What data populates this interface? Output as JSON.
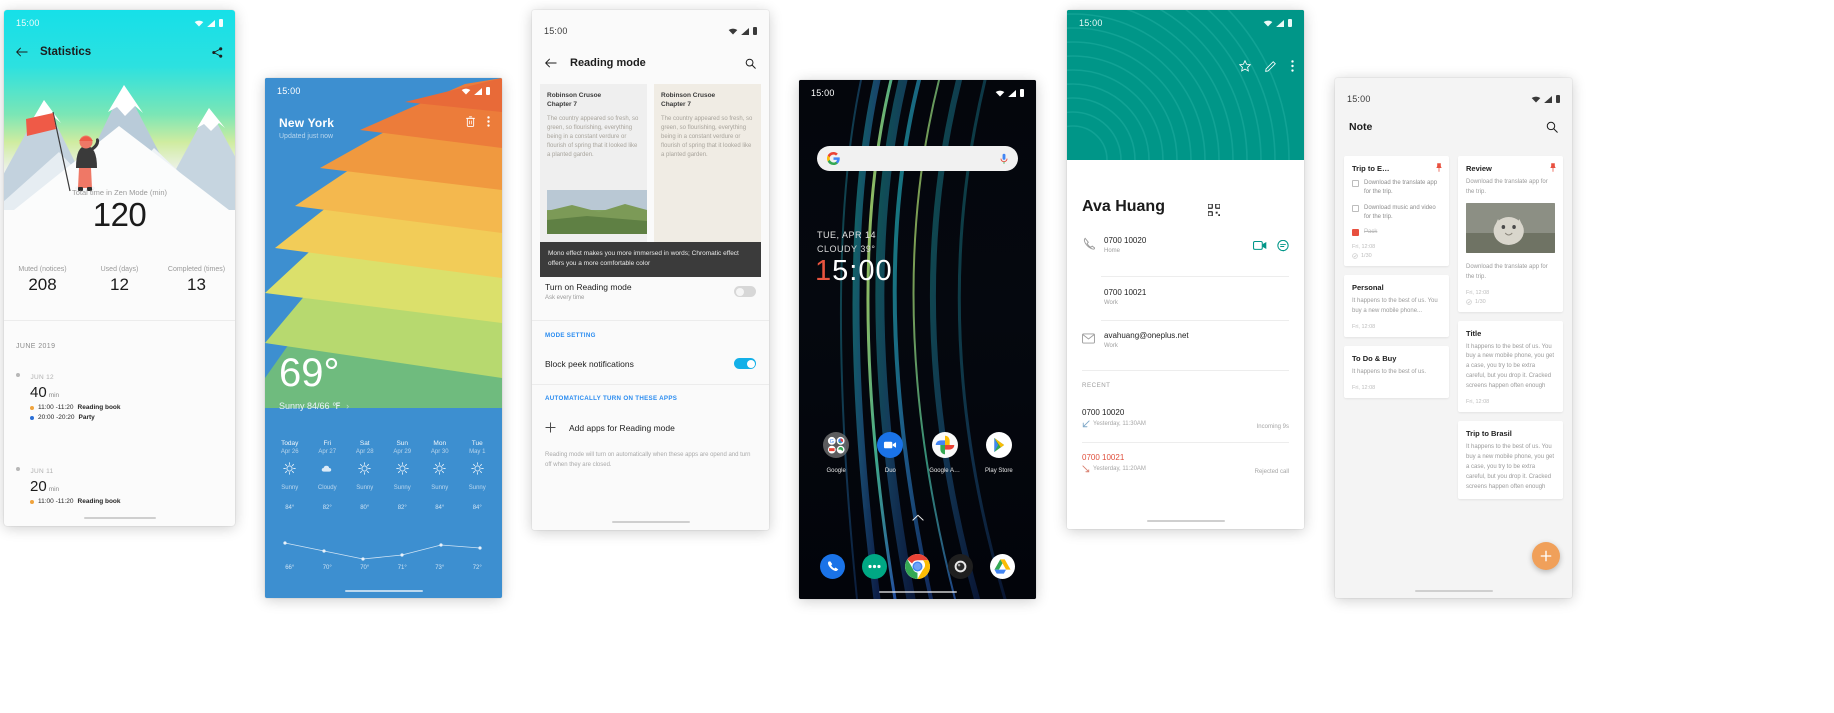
{
  "panels": {
    "zen": {
      "status_time": "15:00",
      "title": "Statistics",
      "back_icon": "arrow-back-icon",
      "share_icon": "share-icon",
      "total_label": "Total time in Zen Mode (min)",
      "total_value": "120",
      "stats": [
        {
          "label": "Muted (notices)",
          "value": "208"
        },
        {
          "label": "Used (days)",
          "value": "12"
        },
        {
          "label": "Completed (times)",
          "value": "13"
        }
      ],
      "month": "JUNE 2019",
      "entries": [
        {
          "day": "JUN 12",
          "minutes": "40",
          "unit": "min",
          "sessions": [
            {
              "time": "11:00 -11:20",
              "name": "Reading book",
              "color": "#f0a33c"
            },
            {
              "time": "20:00 -20:20",
              "name": "Party",
              "color": "#2a6fd6"
            }
          ]
        },
        {
          "day": "JUN 11",
          "minutes": "20",
          "unit": "min",
          "sessions": [
            {
              "time": "11:00 -11:20",
              "name": "Reading book",
              "color": "#f0a33c"
            }
          ]
        }
      ]
    },
    "weather": {
      "status_time": "15:00",
      "city": "New York",
      "city_sub": "Updated just now",
      "delete_icon": "trash-icon",
      "more_icon": "more-vert-icon",
      "temperature": "69°",
      "condition": "Sunny 84/66 ℉",
      "chevron": "chevron-right-icon",
      "forecast": [
        {
          "day": "Today",
          "date": "Apr 26",
          "icon": "sun-icon",
          "desc": "Sunny",
          "high": "84°",
          "low": "66°"
        },
        {
          "day": "Fri",
          "date": "Apr 27",
          "icon": "cloud-icon",
          "desc": "Cloudy",
          "high": "82°",
          "low": "70°"
        },
        {
          "day": "Sat",
          "date": "Apr 28",
          "icon": "sun-icon",
          "desc": "Sunny",
          "high": "80°",
          "low": "70°"
        },
        {
          "day": "Sun",
          "date": "Apr 29",
          "icon": "sun-icon",
          "desc": "Sunny",
          "high": "82°",
          "low": "71°"
        },
        {
          "day": "Mon",
          "date": "Apr 30",
          "icon": "sun-icon",
          "desc": "Sunny",
          "high": "84°",
          "low": "73°"
        },
        {
          "day": "Tue",
          "date": "May 1",
          "icon": "sun-icon",
          "desc": "Sunny",
          "high": "84°",
          "low": "72°"
        }
      ]
    },
    "reading": {
      "status_time": "15:00",
      "title": "Reading mode",
      "back_icon": "arrow-back-icon",
      "search_icon": "search-icon",
      "preview_cards": [
        {
          "title_line1": "Robinson Crusoe",
          "title_line2": "Chapter 7",
          "body": "The country appeared so fresh, so green, so flourishing, everything being in a constant verdure or flourish of spring that it looked like a planted garden."
        },
        {
          "title_line1": "Robinson Crusoe",
          "title_line2": "Chapter 7",
          "body": "The country appeared so fresh, so green, so flourishing, everything being in a constant verdure or flourish of spring that it looked like a planted garden."
        }
      ],
      "toast": "Mono effect makes you more immersed in words; Chromatic effect offers you a more comfortable color",
      "turn_on_title": "Turn on Reading mode",
      "turn_on_sub": "Ask every time",
      "turn_on_state": "off",
      "mode_setting_header": "MODE SETTING",
      "block_peek_title": "Block peek notifications",
      "block_peek_state": "on",
      "auto_header": "AUTOMATICALLY TURN ON THESE APPS",
      "add_apps_label": "Add apps for Reading mode",
      "add_icon": "plus-icon",
      "footer": "Reading mode will turn on automatically when these apps are opend and turn off when they are closed."
    },
    "home": {
      "status_time": "15:00",
      "search_logo": "google-g-icon",
      "mic_icon": "microphone-icon",
      "date": "TUE, APR 14",
      "condition": "CLOUDY 39°",
      "clock_red": "1",
      "clock_rest": "5:00",
      "apps": [
        {
          "label": "Google",
          "icon": "google-folder-icon"
        },
        {
          "label": "Duo",
          "icon": "duo-icon"
        },
        {
          "label": "Google A…",
          "icon": "google-photos-icon"
        },
        {
          "label": "Play Store",
          "icon": "play-store-icon"
        }
      ],
      "chevron_up_icon": "chevron-up-icon",
      "dock": [
        {
          "icon": "phone-icon"
        },
        {
          "icon": "messages-icon"
        },
        {
          "icon": "chrome-icon"
        },
        {
          "icon": "camera-icon"
        },
        {
          "icon": "drive-icon"
        }
      ]
    },
    "contact": {
      "status_time": "15:00",
      "star_icon": "star-outline-icon",
      "edit_icon": "pencil-icon",
      "more_icon": "more-vert-icon",
      "name": "Ava Huang",
      "qr_icon": "qr-code-icon",
      "details": [
        {
          "icon": "phone-icon",
          "value": "0700 10020",
          "label": "Home",
          "actions": [
            "video-call-icon",
            "message-icon"
          ]
        },
        {
          "icon": "",
          "value": "0700 10021",
          "label": "Work",
          "actions": []
        },
        {
          "icon": "mail-icon",
          "value": "avahuang@oneplus.net",
          "label": "Work",
          "actions": []
        }
      ],
      "recent_header": "RECENT",
      "recent": [
        {
          "number": "0700 10020",
          "meta": "Yesterday, 11:30AM",
          "type": "Incoming 9s",
          "missed": false,
          "icon": "call-received-icon"
        },
        {
          "number": "0700 10021",
          "meta": "Yesterday, 11:20AM",
          "type": "Rejected call",
          "missed": true,
          "icon": "call-missed-icon"
        }
      ]
    },
    "notes": {
      "status_time": "15:00",
      "title": "Note",
      "search_icon": "search-icon",
      "fab_icon": "plus-icon",
      "columns": [
        {
          "cards": [
            {
              "title": "Trip to E…",
              "pinned": true,
              "checklist": [
                {
                  "text": "Download the translate app for the trip.",
                  "done": false
                },
                {
                  "text": "Download music and video for the trip.",
                  "done": false
                },
                {
                  "text": "Pack",
                  "done": true
                }
              ],
              "date": "Fri, 12:08",
              "progress": "1/30"
            },
            {
              "title": "Personal",
              "pinned": false,
              "body": "It happens to the best of us. You buy a new mobile phone...",
              "date": "Fri, 12:08"
            },
            {
              "title": "To Do & Buy",
              "pinned": false,
              "body": "It happens to the best of us.",
              "date": "Fri, 12:08"
            }
          ]
        },
        {
          "cards": [
            {
              "title": "Review",
              "pinned": true,
              "body": "Download the translate app for the trip.",
              "has_image": true,
              "body2": "Download the translate app for the trip.",
              "date": "Fri, 12:08",
              "progress": "1/30"
            },
            {
              "title": "Title",
              "pinned": false,
              "body": "It happens to the best of us. You buy a new mobile phone, you get a case, you try to be extra careful, but you drop it. Cracked screens happen often enough",
              "date": "Fri, 12:08"
            },
            {
              "title": "Trip to Brasil",
              "pinned": false,
              "body": "It happens to the best of us. You buy a new mobile phone, you get a case, you try to be extra careful, but you drop it. Cracked screens happen often enough"
            }
          ]
        }
      ]
    }
  }
}
